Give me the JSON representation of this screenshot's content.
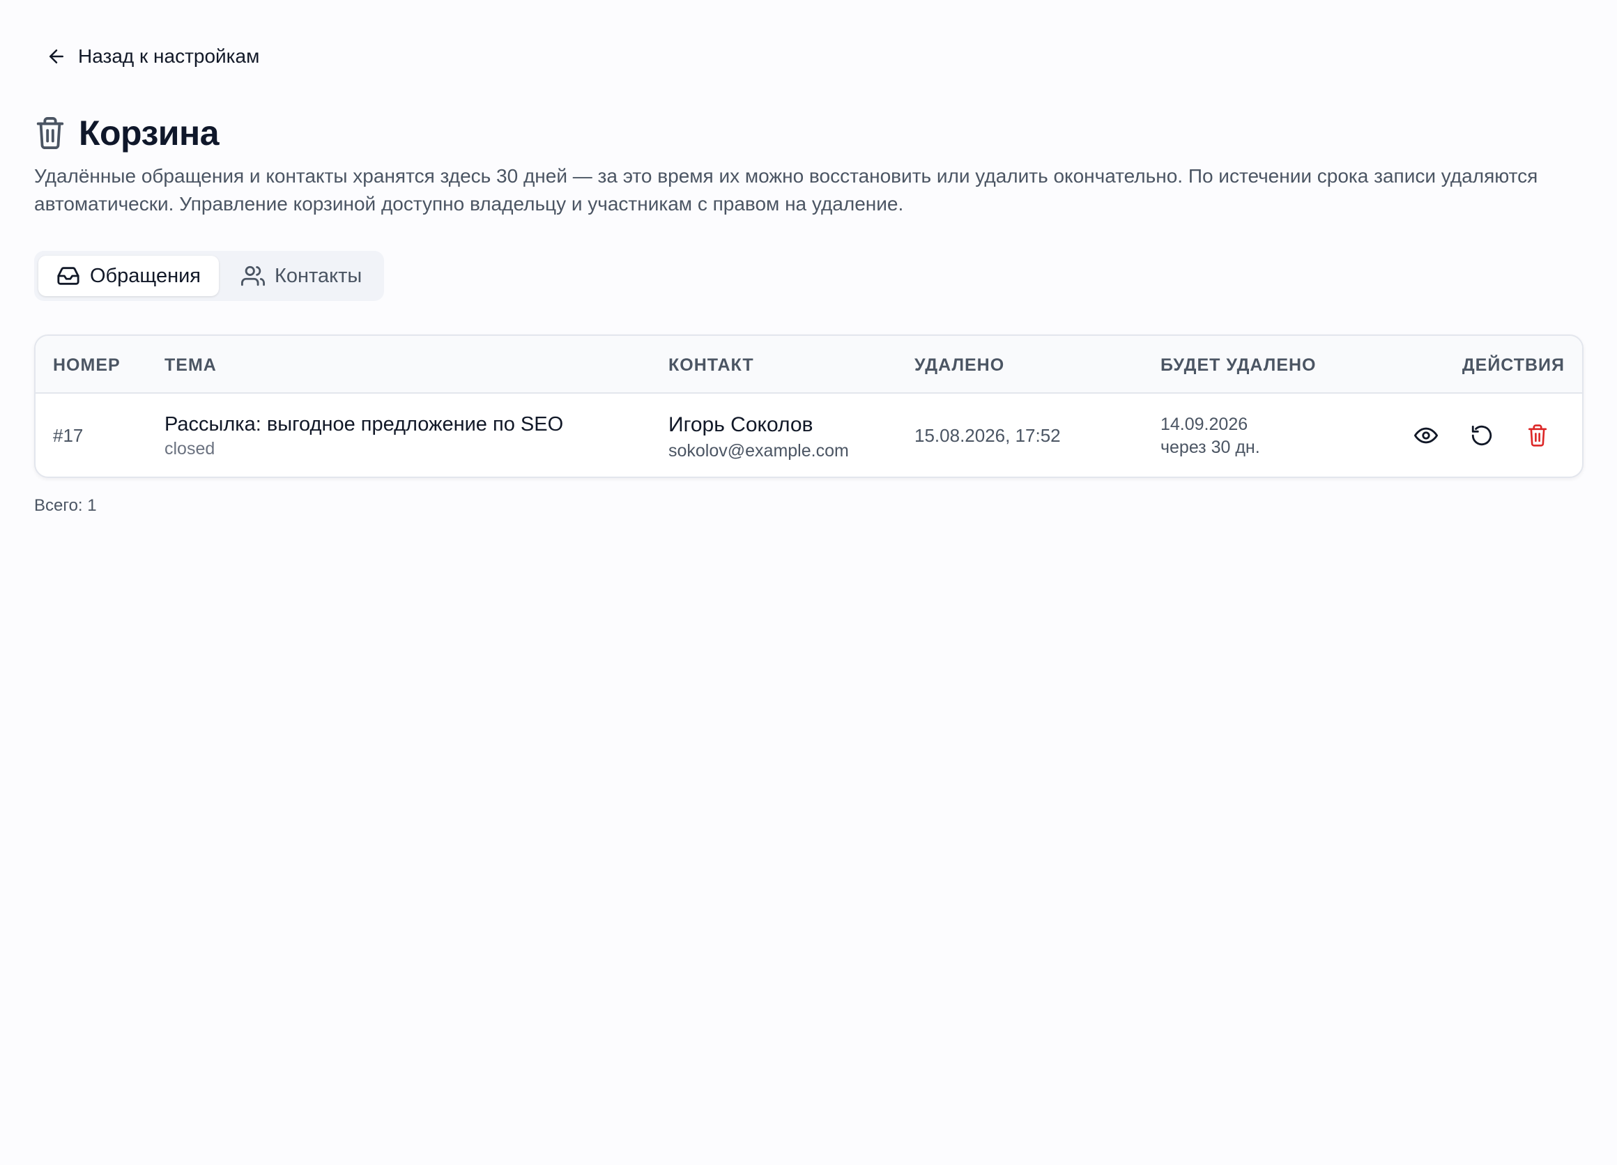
{
  "back": {
    "label": "Назад к настройкам",
    "icon": "arrow-left-icon"
  },
  "header": {
    "title": "Корзина",
    "icon": "trash-icon",
    "description": "Удалённые обращения и контакты хранятся здесь 30 дней — за это время их можно восстановить или удалить окончательно. По истечении срока записи удаляются автоматически. Управление корзиной доступно владельцу и участникам с правом на удаление."
  },
  "tabs": [
    {
      "label": "Обращения",
      "icon": "inbox-icon",
      "active": true
    },
    {
      "label": "Контакты",
      "icon": "users-icon",
      "active": false
    }
  ],
  "table": {
    "columns": [
      "НОМЕР",
      "ТЕМА",
      "КОНТАКТ",
      "УДАЛЕНО",
      "БУДЕТ УДАЛЕНО",
      "ДЕЙСТВИЯ"
    ],
    "rows": [
      {
        "number": "#17",
        "subject": "Рассылка: выгодное предложение по SEO",
        "status": "closed",
        "contact_name": "Игорь Соколов",
        "contact_email": "sokolov@example.com",
        "deleted_at": "15.08.2026, 17:52",
        "will_delete_date": "14.09.2026",
        "will_delete_in": "через 30 дн.",
        "actions": [
          "eye-icon",
          "restore-icon",
          "trash-icon"
        ]
      }
    ]
  },
  "footer": {
    "total": "Всего: 1"
  },
  "colors": {
    "danger": "#dc2626",
    "text": "#111827",
    "muted": "#4b5563"
  }
}
